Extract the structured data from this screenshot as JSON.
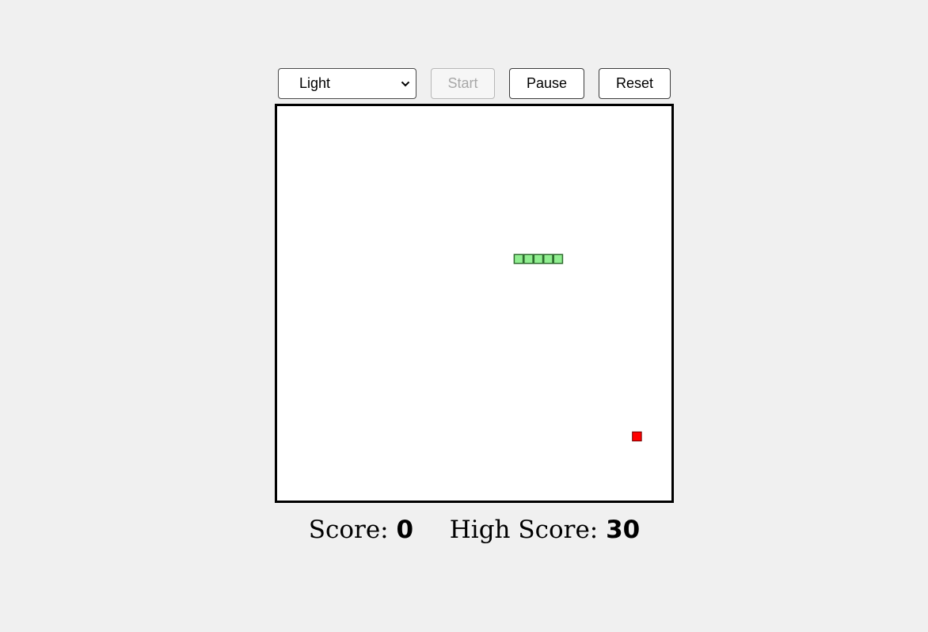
{
  "controls": {
    "theme_select": {
      "selected": "Light",
      "icon": "chevron-down-icon"
    },
    "start_label": "Start",
    "start_disabled": true,
    "pause_label": "Pause",
    "reset_label": "Reset"
  },
  "game": {
    "grid_size": 40,
    "snake_color": "#90ee90",
    "snake_border_color": "#2e6b2e",
    "food_color": "#ff0000",
    "food_border_color": "#6b0000",
    "snake": [
      [
        24,
        15
      ],
      [
        25,
        15
      ],
      [
        26,
        15
      ],
      [
        27,
        15
      ],
      [
        28,
        15
      ]
    ],
    "food": [
      36,
      33
    ]
  },
  "score": {
    "label": "Score:",
    "value": "0",
    "high_label": "High Score:",
    "high_value": "30"
  }
}
